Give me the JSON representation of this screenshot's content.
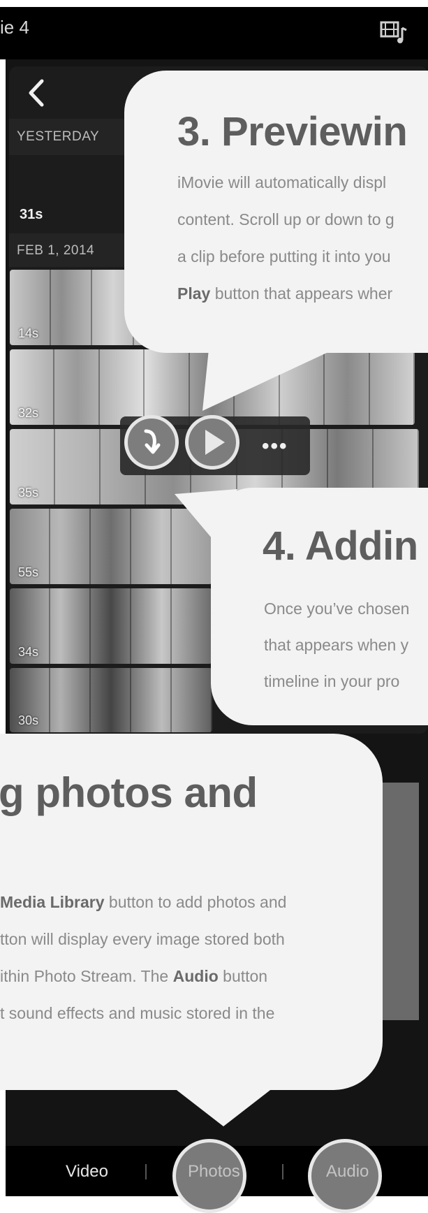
{
  "top_bar": {
    "title": "ie 4",
    "media_icon": "film-music-icon"
  },
  "library": {
    "back_icon": "chevron-left-icon",
    "sections": [
      {
        "label": "YESTERDAY"
      },
      {
        "label": "FEB 1, 2014"
      }
    ],
    "yesterday_duration": "31s",
    "clips": [
      {
        "duration": "14s"
      },
      {
        "duration": "32s"
      },
      {
        "duration": "35s"
      },
      {
        "duration": "55s"
      },
      {
        "duration": "34s"
      },
      {
        "duration": "30s"
      }
    ],
    "clip_actions": {
      "add_icon": "arrow-down-icon",
      "play_icon": "play-icon",
      "more_label": "•••"
    }
  },
  "tabs": [
    {
      "label": "Video"
    },
    {
      "label": "Photos"
    },
    {
      "label": "Audio"
    }
  ],
  "callouts": {
    "previewing": {
      "title": "3. Previewin",
      "lines": [
        "iMovie will automatically displ",
        "content. Scroll up or down to g",
        "a clip before putting it into you"
      ],
      "line4_bold": "Play",
      "line4_rest": " button that appears wher"
    },
    "adding": {
      "title": "4. Addin",
      "lines": [
        "Once you’ve chosen",
        "that appears when y",
        "timeline in your pro"
      ]
    },
    "photos": {
      "title": "g photos and",
      "line1_bold": "Media Library",
      "line1_rest": " button to add photos and",
      "line2": "tton will display every image stored both",
      "line3_pre": "ithin Photo Stream. The ",
      "line3_bold": "Audio",
      "line3_rest": " button",
      "line4": "t sound effects and music stored in the"
    }
  }
}
